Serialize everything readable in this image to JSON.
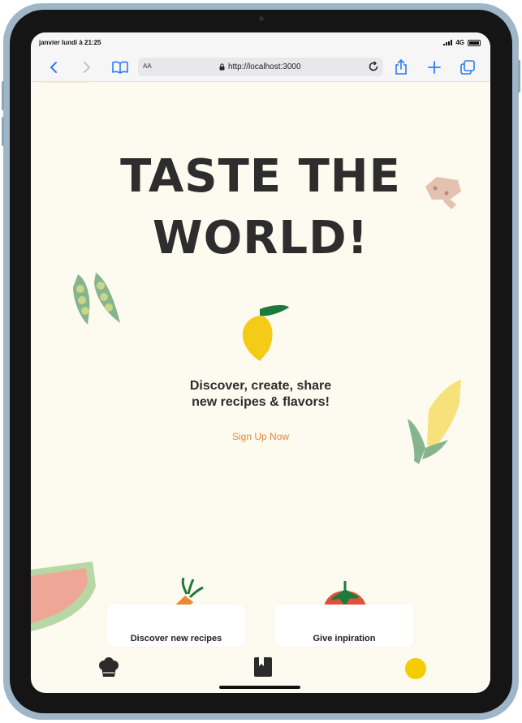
{
  "status": {
    "time": "janvier lundi à 21:25",
    "network": "4G"
  },
  "browser": {
    "text_size_label": "AA",
    "url": "http://localhost:3000"
  },
  "hero": {
    "title_line1": "TASTE THE",
    "title_line2": "WORLD!",
    "tagline_line1": "Discover, create, share",
    "tagline_line2": "new recipes & flavors!",
    "cta": "Sign Up Now"
  },
  "cards": [
    {
      "label": "Discover new recipes"
    },
    {
      "label": "Give inpiration"
    }
  ],
  "colors": {
    "background": "#fdfaf0",
    "title": "#2d2d2d",
    "accent": "#e8873a",
    "link_blue": "#2a7bf6",
    "profile_dot": "#f5cc00"
  },
  "tabbar": {
    "icons": [
      "chef-hat-icon",
      "recipe-book-icon",
      "profile-dot-icon"
    ]
  }
}
